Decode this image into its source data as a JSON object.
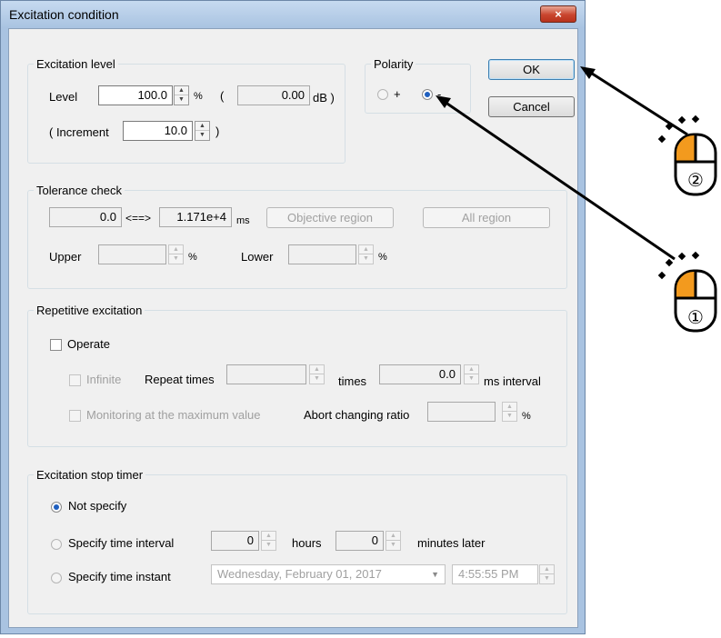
{
  "window": {
    "title": "Excitation condition",
    "close_glyph": "×"
  },
  "excitation_level": {
    "group_title": "Excitation level",
    "level_label": "Level",
    "level_value": "100.0",
    "level_unit": "%",
    "paren_open": "(",
    "db_value": "0.00",
    "db_unit": "dB )",
    "increment_label": "( Increment",
    "increment_value": "10.0",
    "paren_close": ")"
  },
  "polarity": {
    "group_title": "Polarity",
    "plus_label": "+",
    "minus_label": "-",
    "selected": "-"
  },
  "buttons": {
    "ok": "OK",
    "cancel": "Cancel"
  },
  "tolerance_check": {
    "group_title": "Tolerance check",
    "from_value": "0.0",
    "arrow": "<==>",
    "to_value": "1.171e+4",
    "unit": "ms",
    "objective_region": "Objective region",
    "all_region": "All region",
    "upper_label": "Upper",
    "upper_unit": "%",
    "lower_label": "Lower",
    "lower_unit": "%"
  },
  "repetitive_excitation": {
    "group_title": "Repetitive excitation",
    "operate_label": "Operate",
    "infinite_label": "Infinite",
    "repeat_times_label": "Repeat times",
    "times_unit": "times",
    "interval_value": "0.0",
    "interval_unit": "ms interval",
    "monitoring_label": "Monitoring at the maximum value",
    "abort_label": "Abort changing ratio",
    "abort_unit": "%"
  },
  "stop_timer": {
    "group_title": "Excitation stop timer",
    "not_specify": "Not specify",
    "specify_interval": "Specify time interval",
    "hours_value": "0",
    "hours_label": "hours",
    "minutes_value": "0",
    "minutes_label": "minutes later",
    "specify_instant": "Specify time instant",
    "date_value": "Wednesday,  February  01, 2017",
    "time_value": "4:55:55 PM",
    "selected": "Not specify"
  },
  "annotations": {
    "mouse_step_1": "①",
    "mouse_step_2": "②",
    "accent_color": "#f39a1e"
  }
}
